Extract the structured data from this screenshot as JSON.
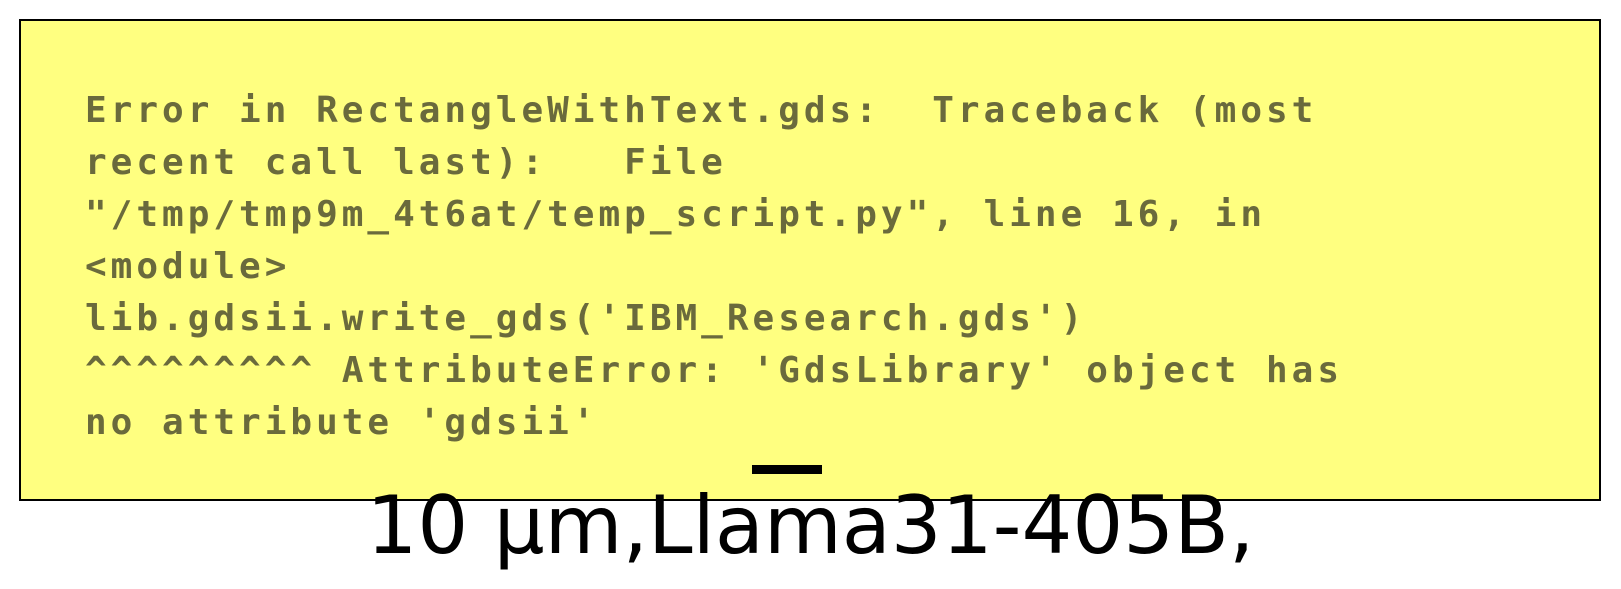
{
  "error": {
    "lines": [
      "Error in RectangleWithText.gds:  Traceback (most",
      "recent call last):   File",
      "\"/tmp/tmp9m_4t6at/temp_script.py\", line 16, in",
      "<module>",
      "lib.gdsii.write_gds('IBM_Research.gds')",
      "^^^^^^^^^ AttributeError: 'GdsLibrary' object has",
      "no attribute 'gdsii'"
    ]
  },
  "caption": {
    "text": "10 µm,Llama31-405B,"
  },
  "colors": {
    "panel_background": "#ffff80",
    "panel_border": "#000000",
    "error_text": "#6a6a3c",
    "caption_text": "#000000"
  }
}
